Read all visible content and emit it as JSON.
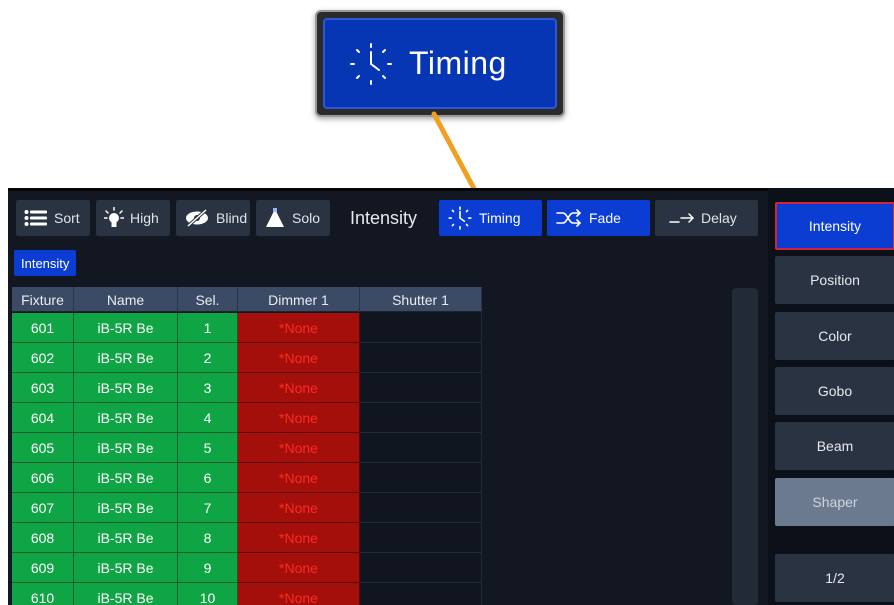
{
  "callout": {
    "label": "Timing",
    "icon": "clock-icon"
  },
  "toolbar": {
    "sort": "Sort",
    "high": "High",
    "blind": "Blind",
    "solo": "Solo",
    "section_label": "Intensity",
    "timing": "Timing",
    "fade": "Fade",
    "delay": "Delay"
  },
  "chip": "Intensity",
  "table": {
    "headers": [
      "Fixture",
      "Name",
      "Sel.",
      "Dimmer 1",
      "Shutter 1"
    ],
    "rows": [
      {
        "fixture": "601",
        "name": "iB-5R Be",
        "sel": "1",
        "dimmer": "*None"
      },
      {
        "fixture": "602",
        "name": "iB-5R Be",
        "sel": "2",
        "dimmer": "*None"
      },
      {
        "fixture": "603",
        "name": "iB-5R Be",
        "sel": "3",
        "dimmer": "*None"
      },
      {
        "fixture": "604",
        "name": "iB-5R Be",
        "sel": "4",
        "dimmer": "*None"
      },
      {
        "fixture": "605",
        "name": "iB-5R Be",
        "sel": "5",
        "dimmer": "*None"
      },
      {
        "fixture": "606",
        "name": "iB-5R Be",
        "sel": "6",
        "dimmer": "*None"
      },
      {
        "fixture": "607",
        "name": "iB-5R Be",
        "sel": "7",
        "dimmer": "*None"
      },
      {
        "fixture": "608",
        "name": "iB-5R Be",
        "sel": "8",
        "dimmer": "*None"
      },
      {
        "fixture": "609",
        "name": "iB-5R Be",
        "sel": "9",
        "dimmer": "*None"
      },
      {
        "fixture": "610",
        "name": "iB-5R Be",
        "sel": "10",
        "dimmer": "*None"
      }
    ]
  },
  "side": {
    "intensity": "Intensity",
    "position": "Position",
    "color": "Color",
    "gobo": "Gobo",
    "beam": "Beam",
    "shaper": "Shaper",
    "page": "1/2"
  },
  "colors": {
    "accent_blue": "#0b3dd2",
    "green_cell": "#10a544",
    "red_cell": "#a40f0c",
    "arrow_orange": "#f0a020"
  }
}
